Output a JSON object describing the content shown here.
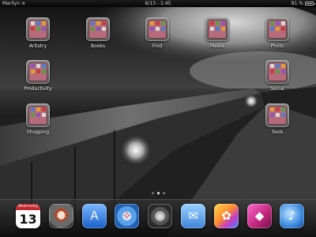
{
  "status_bar": {
    "carrier": "Marilyn",
    "wifi_icon": "wifi-icon",
    "time": "6/13 - 1:45",
    "battery_percent": "81 %",
    "battery_icon": "battery-icon"
  },
  "folders": [
    {
      "id": "artistry",
      "label": "Artistry"
    },
    {
      "id": "books",
      "label": "Books"
    },
    {
      "id": "find",
      "label": "Find"
    },
    {
      "id": "media",
      "label": "Media"
    },
    {
      "id": "photo",
      "label": "Photo"
    },
    {
      "id": "productivity",
      "label": "Productivity"
    },
    {
      "id": "social",
      "label": "Social"
    },
    {
      "id": "shopping",
      "label": "Shopping"
    },
    {
      "id": "tools",
      "label": "Tools"
    }
  ],
  "folder_colors": {
    "folder_background": "#b56b7a",
    "mini_icons": [
      "#d9d9d9",
      "#4a7fd0",
      "#e0a030",
      "#c83c3c",
      "#56a04a",
      "#8a55c0"
    ]
  },
  "page_indicator": {
    "pages": 3,
    "current": 2
  },
  "dock": [
    {
      "id": "calendar",
      "icon": "calendar-icon",
      "day": "Wednesday",
      "date": "13"
    },
    {
      "id": "settings",
      "icon": "settings-gear-icon"
    },
    {
      "id": "app-store",
      "icon": "app-store-icon"
    },
    {
      "id": "safari",
      "icon": "safari-compass-icon"
    },
    {
      "id": "system",
      "icon": "system-dial-icon"
    },
    {
      "id": "mail",
      "icon": "mail-envelope-icon"
    },
    {
      "id": "photos",
      "icon": "photos-flower-icon"
    },
    {
      "id": "gem",
      "icon": "gem-icon"
    },
    {
      "id": "music",
      "icon": "music-note-icon"
    }
  ]
}
